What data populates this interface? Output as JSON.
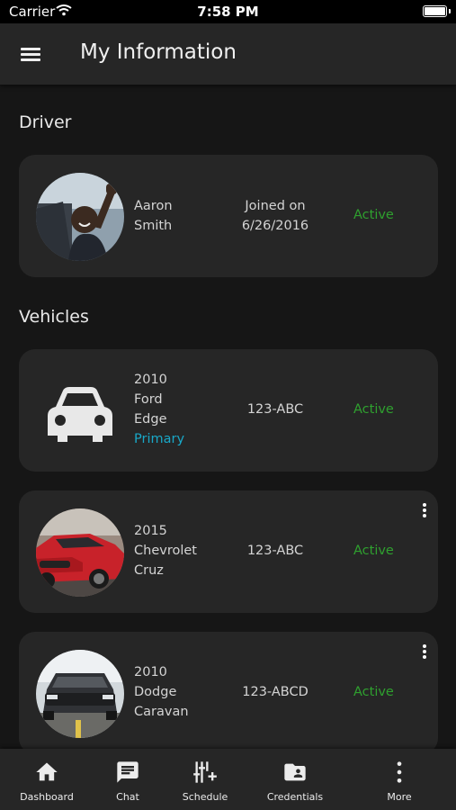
{
  "status_bar": {
    "carrier": "Carrier",
    "time": "7:58 PM"
  },
  "header": {
    "title": "My Information",
    "menu_icon": "hamburger-menu-icon"
  },
  "driver_section": {
    "title": "Driver",
    "card": {
      "first_name": "Aaron",
      "last_name": "Smith",
      "joined_label": "Joined on",
      "joined_date": "6/26/2016",
      "status": "Active"
    }
  },
  "vehicles_section": {
    "title": "Vehicles",
    "vehicles": [
      {
        "year": "2010",
        "make": "Ford",
        "model": "Edge",
        "tag": "Primary",
        "plate": "123-ABC",
        "status": "Active",
        "image": "car-placeholder-icon"
      },
      {
        "year": "2015",
        "make": "Chevrolet",
        "model": "Cruz",
        "plate": "123-ABC",
        "status": "Active",
        "image": "red-car-photo"
      },
      {
        "year": "2010",
        "make": "Dodge",
        "model": "Caravan",
        "plate": "123-ABCD",
        "status": "Active",
        "image": "dark-car-photo"
      }
    ]
  },
  "bottom_nav": [
    {
      "label": "Dashboard",
      "icon": "home-icon"
    },
    {
      "label": "Chat",
      "icon": "chat-icon"
    },
    {
      "label": "Schedule",
      "icon": "schedule-icon"
    },
    {
      "label": "Credentials",
      "icon": "credentials-folder-icon"
    },
    {
      "label": "More",
      "icon": "more-vertical-icon"
    }
  ],
  "colors": {
    "background": "#161616",
    "card": "#262626",
    "active_status": "#2fa02f",
    "primary_tag": "#19a8c8"
  }
}
